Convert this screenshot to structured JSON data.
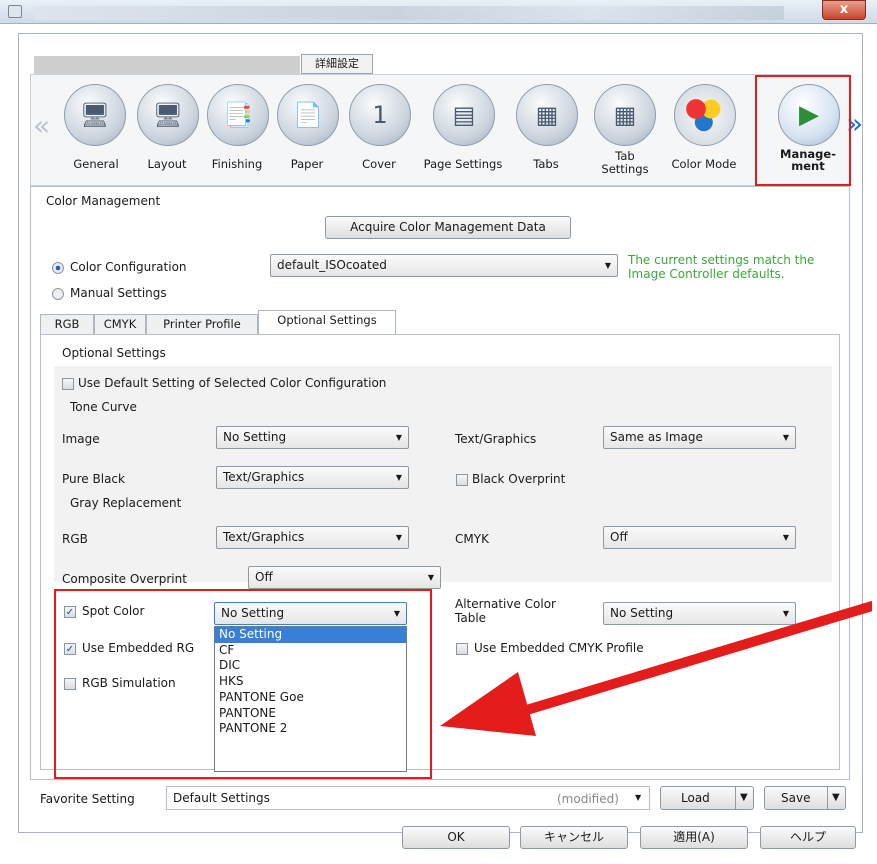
{
  "window": {
    "close_label": "x",
    "detail_tab": "詳細設定"
  },
  "toolbar": {
    "items": [
      {
        "label": "General",
        "icon": "printer-general-icon"
      },
      {
        "label": "Layout",
        "icon": "printer-layout-icon"
      },
      {
        "label": "Finishing",
        "icon": "finishing-pages-icon"
      },
      {
        "label": "Paper",
        "icon": "paper-icon"
      },
      {
        "label": "Cover",
        "icon": "cover-page-icon"
      },
      {
        "label": "Page Settings",
        "icon": "page-settings-icon"
      },
      {
        "label": "Tabs",
        "icon": "tabs-icon"
      },
      {
        "label": "Tab Settings",
        "icon": "tab-settings-icon"
      },
      {
        "label": "Color Mode",
        "icon": "color-mode-icon"
      },
      {
        "label": "Manage-\nment",
        "icon": "color-management-icon"
      }
    ],
    "prev_arrow": "«",
    "next_arrow": "»",
    "highlight_color": "#e41c1c"
  },
  "color_management": {
    "title": "Color Management",
    "acquire_button": "Acquire Color Management Data",
    "config_radio": "Color Configuration",
    "manual_radio": "Manual Settings",
    "config_value": "default_ISOcoated",
    "status_message": "The current settings match the Image Controller defaults.",
    "status_color": "#3ba83b"
  },
  "tabs": [
    "RGB",
    "CMYK",
    "Printer Profile",
    "Optional Settings"
  ],
  "optional": {
    "section_title": "Optional Settings",
    "use_default_label": "Use Default Setting of Selected Color Configuration",
    "tone_curve_title": "Tone Curve",
    "image_label": "Image",
    "image_value": "No Setting",
    "text_graphics_label": "Text/Graphics",
    "text_graphics_value": "Same as Image",
    "pure_black_label": "Pure Black",
    "pure_black_value": "Text/Graphics",
    "black_overprint_label": "Black Overprint",
    "gray_replacement_title": "Gray Replacement",
    "rgb_label": "RGB",
    "rgb_value": "Text/Graphics",
    "cmyk_label": "CMYK",
    "cmyk_value": "Off",
    "composite_overprint_label": "Composite Overprint",
    "composite_overprint_value": "Off",
    "spot_color_label": "Spot Color",
    "spot_color_value": "No Setting",
    "alt_color_table_label": "Alternative Color Table",
    "alt_color_table_value": "No Setting",
    "use_embedded_rgb_label": "Use Embedded RG",
    "use_embedded_cmyk_label": "Use Embedded CMYK Profile",
    "rgb_simulation_label": "RGB Simulation",
    "spot_color_options": [
      "No Setting",
      "CF",
      "DIC",
      "HKS",
      "PANTONE Goe",
      "PANTONE",
      "PANTONE 2"
    ]
  },
  "footer": {
    "favorite_label": "Favorite Setting",
    "favorite_value": "Default Settings",
    "modified": "(modified)",
    "load": "Load",
    "save": "Save",
    "ok": "OK",
    "cancel": "キャンセル",
    "apply": "適用(A)",
    "help": "ヘルプ"
  }
}
